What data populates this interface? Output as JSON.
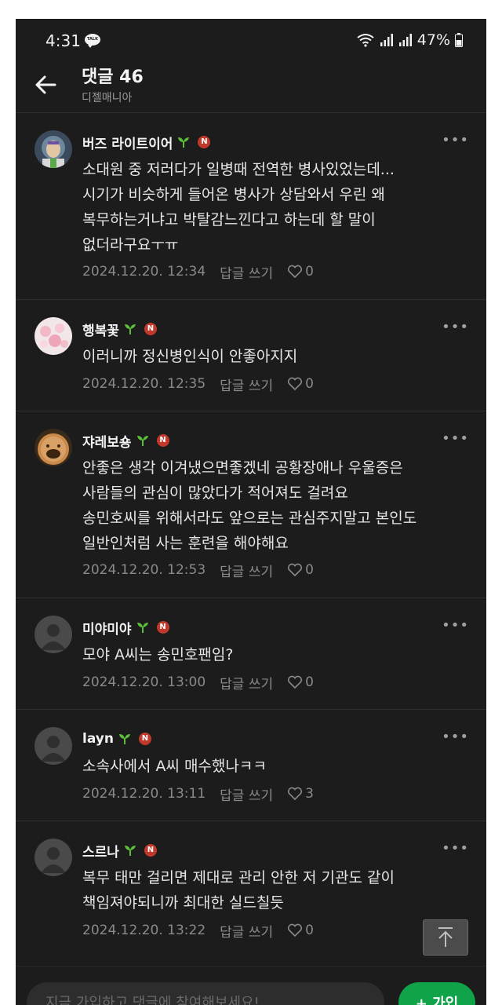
{
  "status_bar": {
    "time": "4:31",
    "talk_icon_label": "TALK",
    "battery": "47%"
  },
  "header": {
    "title": "댓글 46",
    "subtitle": "디젤매니아"
  },
  "comments": [
    {
      "author": "버즈 라이트이어",
      "text": "소대원 중 저러다가 일병때 전역한 병사있었는데...\n시기가 비슷하게 들어온 병사가 상담와서 우린 왜\n복무하는거냐고 박탈감느낀다고 하는데 할 말이\n없더라구요ㅜㅠ",
      "date": "2024.12.20. 12:34",
      "reply": "답글 쓰기",
      "likes": "0"
    },
    {
      "author": "행복꽃",
      "text": "이러니까 정신병인식이 안좋아지지",
      "date": "2024.12.20. 12:35",
      "reply": "답글 쓰기",
      "likes": "0"
    },
    {
      "author": "쟈레보숑",
      "text": "안좋은 생각 이겨냈으면좋겠네 공황장애나 우울증은\n사람들의 관심이 많았다가 적어져도 걸려요\n송민호씨를 위해서라도 앞으로는 관심주지말고 본인도\n일반인처럼 사는 훈련을 해야해요",
      "date": "2024.12.20. 12:53",
      "reply": "답글 쓰기",
      "likes": "0"
    },
    {
      "author": "미야미야",
      "text": "모야 A씨는 송민호팬임?",
      "date": "2024.12.20. 13:00",
      "reply": "답글 쓰기",
      "likes": "0"
    },
    {
      "author": "layn",
      "text": "소속사에서 A씨 매수했나ㅋㅋ",
      "date": "2024.12.20. 13:11",
      "reply": "답글 쓰기",
      "likes": "3"
    },
    {
      "author": "스르나",
      "text": "복무 태만 걸리면 제대로 관리 안한 저 기관도 같이\n책임져야되니까 최대한 실드칠듯",
      "date": "2024.12.20. 13:22",
      "reply": "답글 쓰기",
      "likes": "0"
    }
  ],
  "badge_letter": "N",
  "more_label": "•••",
  "bottom_bar": {
    "placeholder": "지금 가입하고 댓글에 참여해보세요!",
    "join_label": "+ 가입"
  }
}
